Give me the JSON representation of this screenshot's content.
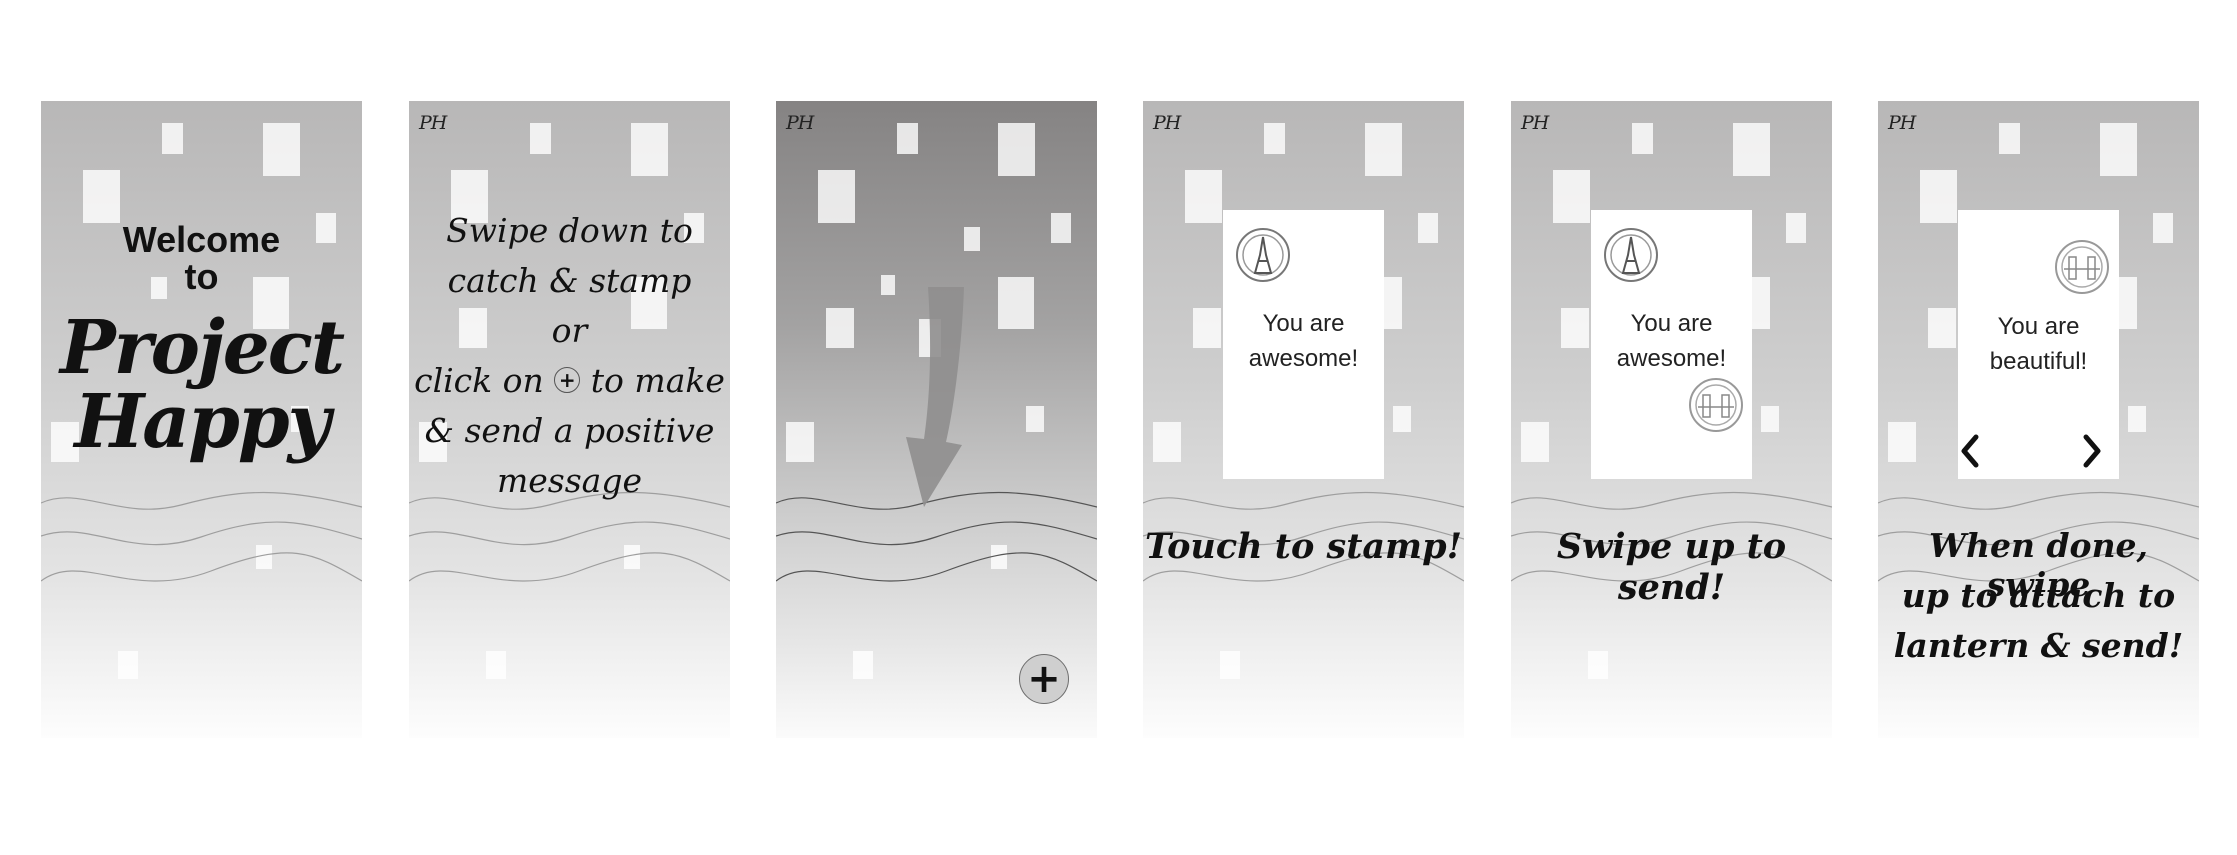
{
  "screens": {
    "s1": {
      "welcome": "Welcome",
      "to": "to",
      "title_line1": "Project",
      "title_line2": "Happy"
    },
    "s2": {
      "logo": "PH",
      "line1": "Swipe down to",
      "line2": "catch & stamp",
      "line3": "or",
      "line4_pre": "click on",
      "line4_post": "to make",
      "line5": "& send a positive",
      "line6": "message",
      "inline_icon": "plus-circle-icon"
    },
    "s3": {
      "logo": "PH",
      "arrow_icon": "swipe-down-arrow-icon",
      "add_button": "+"
    },
    "s4": {
      "logo": "PH",
      "card_line1": "You are",
      "card_line2": "awesome!",
      "stamp": "eiffel-tower-stamp-icon",
      "caption": "Touch to stamp!"
    },
    "s5": {
      "logo": "PH",
      "card_line1": "You are",
      "card_line2": "awesome!",
      "stamps": [
        "eiffel-tower-stamp-icon",
        "tower-bridge-stamp-icon"
      ],
      "caption": "Swipe up to send!"
    },
    "s6": {
      "logo": "PH",
      "card_line1": "You are",
      "card_line2": "beautiful!",
      "stamp": "tower-bridge-stamp-icon",
      "prev_icon": "chevron-left-icon",
      "next_icon": "chevron-right-icon",
      "caption_line1": "When done, swipe",
      "caption_line2": "up to attach to",
      "caption_line3": "lantern & send!"
    }
  },
  "colors": {
    "background": "#ffffff",
    "screen_top": "#b8b7b7",
    "screen_dark_top": "#858383",
    "text": "#111111",
    "card": "#ffffff"
  }
}
